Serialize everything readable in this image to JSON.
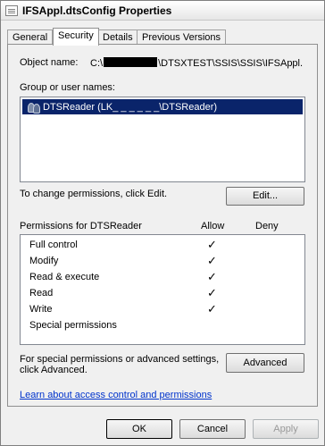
{
  "window": {
    "title": "IFSAppl.dtsConfig Properties",
    "icon": "file-icon"
  },
  "tabs": [
    {
      "label": "General",
      "active": false
    },
    {
      "label": "Security",
      "active": true
    },
    {
      "label": "Details",
      "active": false
    },
    {
      "label": "Previous Versions",
      "active": false
    }
  ],
  "security": {
    "object_name_label": "Object name:",
    "object_name_prefix": "C:\\",
    "object_name_suffix": "\\DTSXTEST\\SSIS\\SSIS\\IFSAppl.",
    "group_label": "Group or user names:",
    "users": [
      {
        "name": "DTSReader (LK_ _ _ _ _ _\\DTSReader)",
        "icon": "users-icon",
        "selected": true
      }
    ],
    "change_text": "To change permissions, click Edit.",
    "edit_button": "Edit...",
    "permissions_for": "Permissions for DTSReader",
    "allow_header": "Allow",
    "deny_header": "Deny",
    "permissions": [
      {
        "name": "Full control",
        "allow": "✓",
        "deny": ""
      },
      {
        "name": "Modify",
        "allow": "✓",
        "deny": ""
      },
      {
        "name": "Read & execute",
        "allow": "✓",
        "deny": ""
      },
      {
        "name": "Read",
        "allow": "✓",
        "deny": ""
      },
      {
        "name": "Write",
        "allow": "✓",
        "deny": ""
      },
      {
        "name": "Special permissions",
        "allow": "",
        "deny": ""
      }
    ],
    "advanced_text_1": "For special permissions or advanced settings,",
    "advanced_text_2": "click Advanced.",
    "advanced_button": "Advanced",
    "learn_link": "Learn about access control and permissions"
  },
  "footer": {
    "ok": "OK",
    "cancel": "Cancel",
    "apply": "Apply"
  }
}
